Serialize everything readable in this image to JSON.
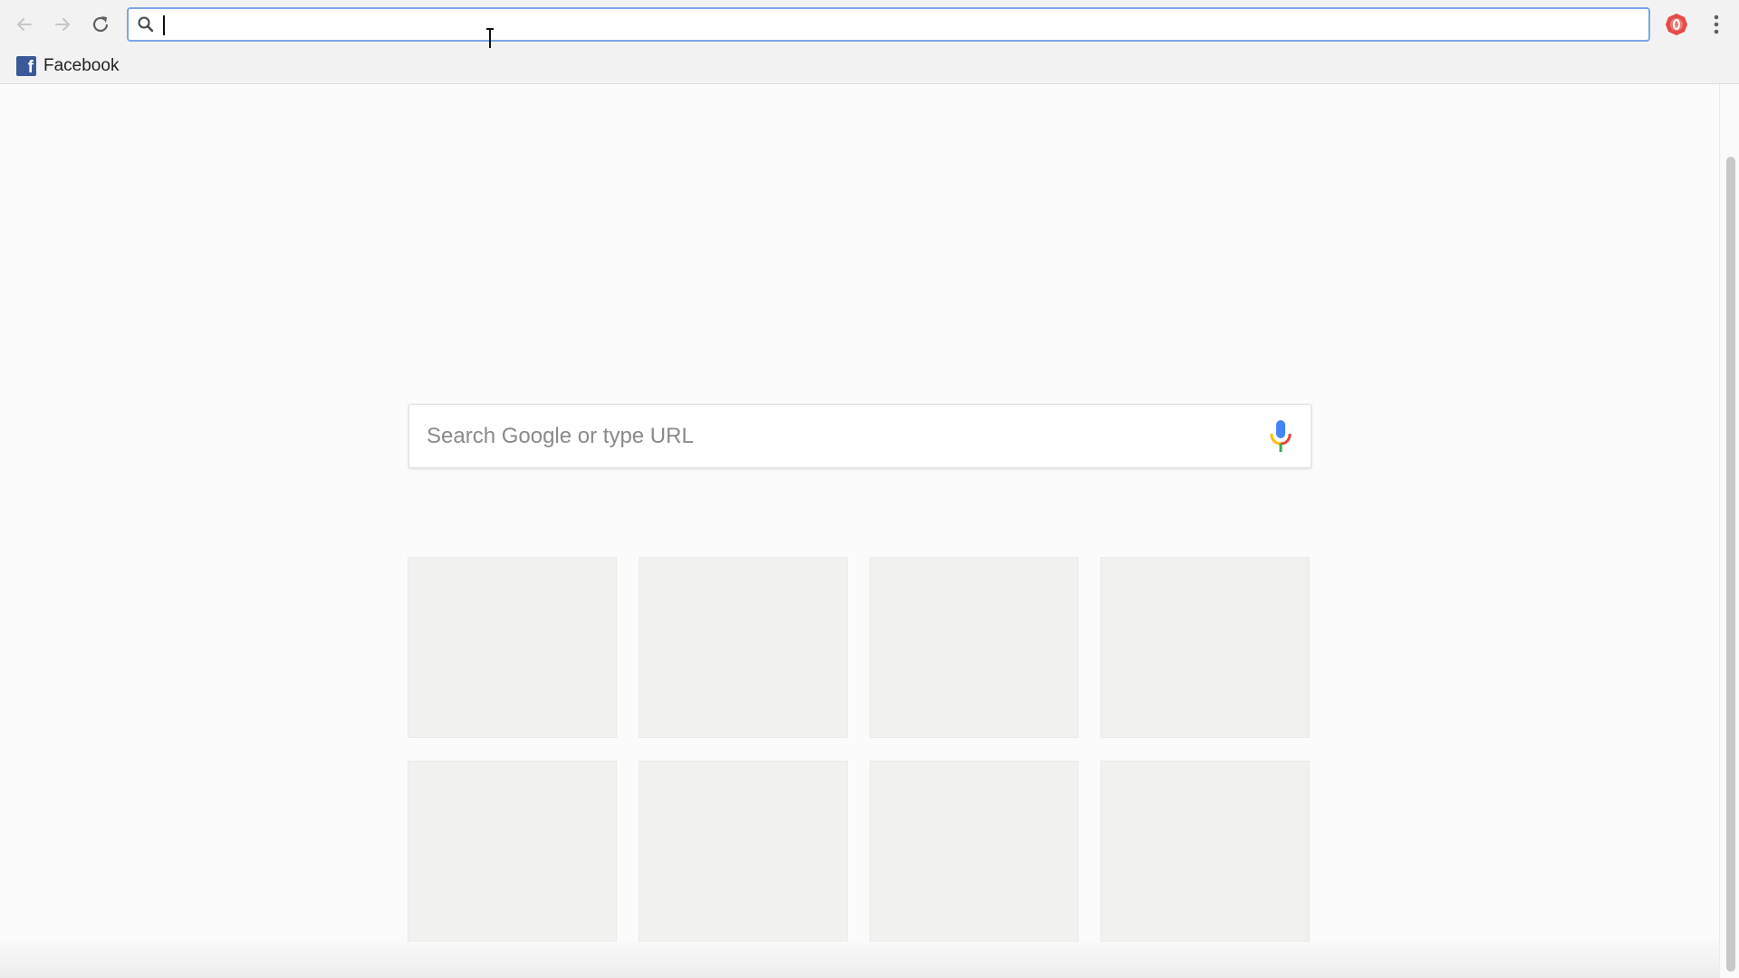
{
  "browser": {
    "omnibox": {
      "value": "",
      "placeholder": ""
    },
    "icons": {
      "back": "arrow-left-icon",
      "forward": "arrow-right-icon",
      "reload": "reload-icon",
      "search": "search-icon",
      "extension": "extension-badge-icon",
      "menu": "kebab-menu-icon"
    },
    "colors": {
      "omnibox_focus": "#7aa7e6",
      "facebook": "#3b5998",
      "extension": "#e64a4a"
    }
  },
  "bookmarks": [
    {
      "label": "Facebook",
      "icon": "facebook-icon"
    }
  ],
  "new_tab": {
    "search_placeholder": "Search Google or type URL",
    "mic_icon": "microphone-icon",
    "tile_count": 8
  }
}
